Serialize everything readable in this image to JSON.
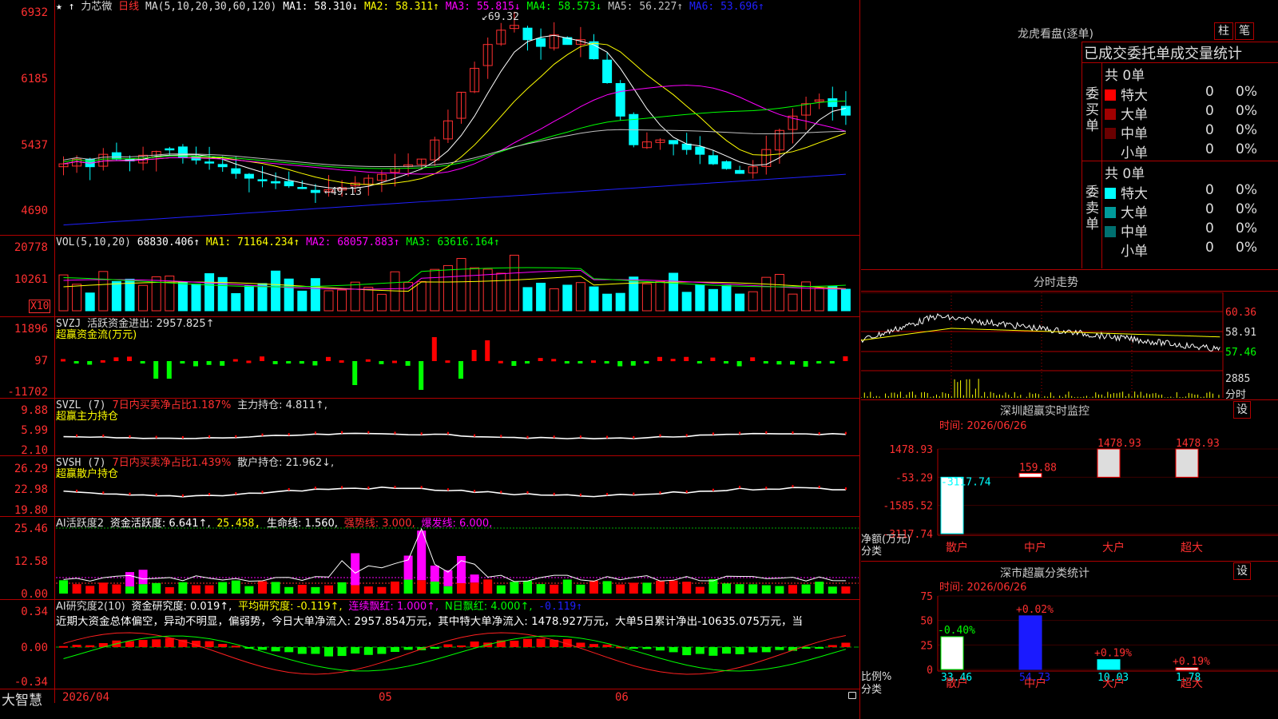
{
  "app": {
    "name": "大智慧"
  },
  "main_chart": {
    "stock_name": "力芯微",
    "period": "日线",
    "ma_label": "MA(5,10,20,30,60,120)",
    "ma1": "MA1: 58.310↓",
    "ma2": "MA2: 58.311↑",
    "ma3": "MA3: 55.815↓",
    "ma4": "MA4: 58.573↓",
    "ma5": "MA5: 56.227↑",
    "ma6": "MA6: 53.696↑",
    "high_mark": "69.32",
    "low_mark": "49.13",
    "y_ticks": [
      "6932",
      "6185",
      "5437",
      "4690"
    ]
  },
  "vol_panel": {
    "label": "VOL(5,10,20)",
    "value": "68830.406↑",
    "ma1": "MA1: 71164.234↑",
    "ma2": "MA2: 68057.883↑",
    "ma3": "MA3: 63616.164↑",
    "y_ticks": [
      "20778",
      "10261"
    ],
    "multiplier": "X10"
  },
  "svzj_panel": {
    "label": "SVZJ",
    "desc": "活跃资金进出: 2957.825↑",
    "sub": "超赢资金流(万元)",
    "y_ticks": [
      "11896",
      "97",
      "-11702"
    ]
  },
  "svzl_panel": {
    "label": "SVZL (7)",
    "desc": "7日内买卖净占比1.187%",
    "hold": "主力持仓: 4.811↑,",
    "sub": "超赢主力持仓",
    "y_ticks": [
      "9.88",
      "5.99",
      "2.10"
    ]
  },
  "svsh_panel": {
    "label": "SVSH (7)",
    "desc": "7日内买卖净占比1.439%",
    "hold": "散户持仓: 21.962↓,",
    "sub": "超赢散户持仓",
    "y_ticks": [
      "26.29",
      "22.98",
      "19.80"
    ]
  },
  "ai2_panel": {
    "label": "AI活跃度2",
    "act": "资金活跃度: 6.641↑,",
    "v2": "25.458,",
    "life": "生命线: 1.560,",
    "strong": "强势线: 3.000,",
    "burst": "爆发线: 6.000,",
    "y_ticks": [
      "25.46",
      "12.58",
      "0.00"
    ]
  },
  "ai_research": {
    "label": "AI研究度2(10)",
    "res": "资金研究度: 0.019↑,",
    "avg": "平均研究度: -0.119↑,",
    "red": "连续飘红: 1.000↑,",
    "nday": "N日飘红: 4.000↑,",
    "last": "-0.119↑",
    "commentary": "近期大资金总体偏空，异动不明显，偏弱势，今日大单净流入: 2957.854万元，其中特大单净流入: 1478.927万元，大单5日累计净出-10635.075万元，当",
    "y_ticks": [
      "0.34",
      "0.00",
      "-0.34"
    ]
  },
  "x_axis": {
    "labels": [
      "2026/04",
      "05",
      "06"
    ]
  },
  "lhb": {
    "title": "龙虎看盘(逐单)",
    "btn1": "柱",
    "btn2": "笔",
    "subtitle": "已成交委托单成交量统计",
    "buy": {
      "side": "委买单",
      "count": "共 0单",
      "rows": [
        {
          "name": "特大",
          "val": "0",
          "pct": "0%",
          "color": "#ff0000"
        },
        {
          "name": "大单",
          "val": "0",
          "pct": "0%",
          "color": "#a00000"
        },
        {
          "name": "中单",
          "val": "0",
          "pct": "0%",
          "color": "#6a0000"
        },
        {
          "name": "小单",
          "val": "0",
          "pct": "0%",
          "color": "#000000"
        }
      ]
    },
    "sell": {
      "side": "委卖单",
      "count": "共 0单",
      "rows": [
        {
          "name": "特大",
          "val": "0",
          "pct": "0%",
          "color": "#00ffff"
        },
        {
          "name": "大单",
          "val": "0",
          "pct": "0%",
          "color": "#009a9a"
        },
        {
          "name": "中单",
          "val": "0",
          "pct": "0%",
          "color": "#007070"
        },
        {
          "name": "小单",
          "val": "0",
          "pct": "0%",
          "color": "#000000"
        }
      ]
    }
  },
  "intraday": {
    "title": "分时走势",
    "y_ticks": [
      "60.36",
      "58.91",
      "57.46"
    ],
    "vol_tick": "2885",
    "vol_label": "分时"
  },
  "sz_monitor": {
    "title": "深圳超赢实时监控",
    "settings": "设",
    "time": "时间: 2026/06/26",
    "y_ticks": [
      "1478.93",
      "-53.29",
      "-1585.52",
      "-3117.74"
    ],
    "y_label": "净额(万元)",
    "x_label": "分类",
    "categories": [
      "散户",
      "中户",
      "大户",
      "超大"
    ],
    "values": [
      -3117.74,
      159.88,
      1478.93,
      1478.93
    ],
    "value_labels": [
      "-3117.74",
      "159.88",
      "1478.93",
      "1478.93"
    ]
  },
  "sz_class": {
    "title": "深市超赢分类统计",
    "settings": "设",
    "time": "时间: 2026/06/26",
    "y_ticks": [
      "75",
      "50",
      "25",
      "0"
    ],
    "y_label": "比例%",
    "x_label": "分类",
    "categories": [
      "散户",
      "中户",
      "大户",
      "超大"
    ],
    "values": [
      33.46,
      54.73,
      10.03,
      1.78
    ],
    "value_labels": [
      "33.46",
      "54.73",
      "10.03",
      "1.78"
    ],
    "changes": [
      "-0.40%",
      "+0.02%",
      "+0.19%",
      "+0.19%"
    ]
  },
  "chart_data": [
    {
      "type": "bar",
      "title": "深圳超赢实时监控",
      "ylabel": "净额(万元)",
      "categories": [
        "散户",
        "中户",
        "大户",
        "超大"
      ],
      "values": [
        -3117.74,
        159.88,
        1478.93,
        1478.93
      ],
      "ylim": [
        -3117.74,
        1478.93
      ]
    },
    {
      "type": "bar",
      "title": "深市超赢分类统计",
      "ylabel": "比例%",
      "categories": [
        "散户",
        "中户",
        "大户",
        "超大"
      ],
      "values": [
        33.46,
        54.73,
        10.03,
        1.78
      ],
      "ylim": [
        0,
        75
      ]
    }
  ]
}
